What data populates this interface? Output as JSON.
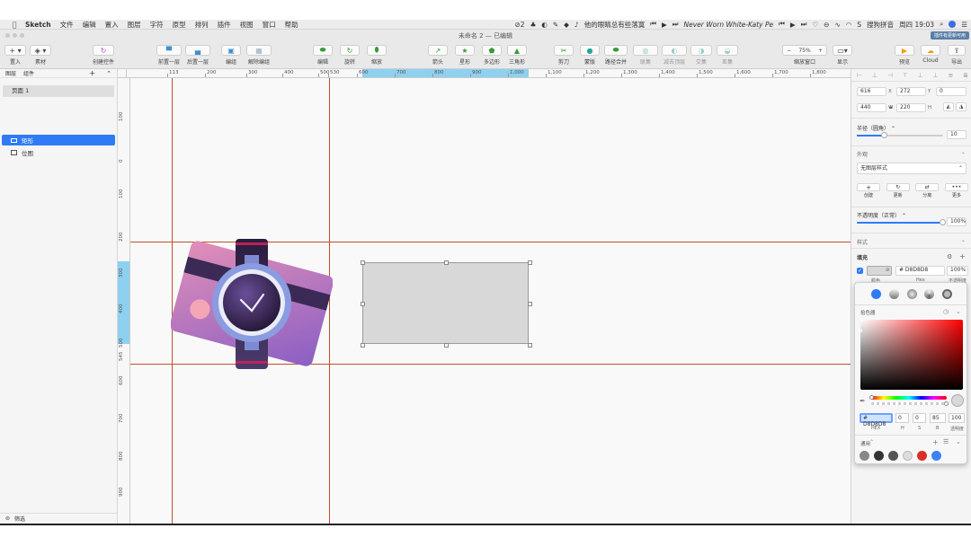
{
  "menubar": {
    "app": "Sketch",
    "items": [
      "文件",
      "编辑",
      "置入",
      "图层",
      "字符",
      "原型",
      "排列",
      "插件",
      "视图",
      "窗口",
      "帮助"
    ],
    "badge_count": "2",
    "song_title": "他的眼睛总有些落寞",
    "track_name": "Never Worn White-Katy Pe",
    "input_method": "搜狗拼音",
    "clock": "周四 19:03"
  },
  "window": {
    "title": "未命名 2 — 已编辑",
    "update_badge": "插件有更新可用"
  },
  "toolbar": {
    "insert": "置入",
    "assets": "素材",
    "create_component": "创建控件",
    "forward": "前置一层",
    "backward": "后置一层",
    "group": "编组",
    "ungroup": "解除编组",
    "edit": "编辑",
    "rotate": "旋转",
    "scale": "缩放",
    "arrow": "箭头",
    "star": "星形",
    "polygon": "多边形",
    "triangle": "三角形",
    "scissors": "剪刀",
    "mask": "蒙版",
    "path_union": "路径合并",
    "union": "联集",
    "subtract": "减去顶层",
    "intersect": "交集",
    "difference": "差集",
    "zoom_value": "75%",
    "zoom_minus": "−",
    "zoom_plus": "+",
    "zoom_label": "缩放窗口",
    "display": "显示",
    "preview": "预览",
    "cloud": "Cloud",
    "export": "导出"
  },
  "left_panel": {
    "tab_pages": "图层",
    "tab_components": "组件",
    "page_name": "页面 1",
    "layers": [
      {
        "name": "矩形",
        "selected": true
      },
      {
        "name": "位图",
        "selected": false
      }
    ],
    "filter": "筛选"
  },
  "ruler_h": {
    "labels": [
      "113",
      "200",
      "300",
      "400",
      "500",
      "530",
      "600",
      "700",
      "800",
      "900",
      "1,000",
      "1,100",
      "1,200",
      "1,300",
      "1,400",
      "1,500",
      "1,600",
      "1,700",
      "1,800"
    ]
  },
  "ruler_v": {
    "labels": [
      "100",
      "0",
      "100",
      "200",
      "300",
      "400",
      "500",
      "545",
      "600",
      "700",
      "800",
      "900"
    ]
  },
  "inspector": {
    "x": "616",
    "x_label": "X",
    "y": "272",
    "y_label": "Y",
    "rotation": "0",
    "w": "440",
    "w_label": "W",
    "h": "220",
    "h_label": "H",
    "radius_label": "半径（圆角）",
    "radius_value": "10",
    "appearance_label": "外观",
    "style_value": "无图层样式",
    "style_actions": [
      "创建",
      "更新",
      "分离",
      "更多"
    ],
    "opacity_label": "不透明度（正常）",
    "opacity_value": "100%",
    "style_section": "样式",
    "fill_label": "填充",
    "fill_hex": "# D8D8D8",
    "fill_opacity": "100%",
    "fill_sublabels": [
      "颜色",
      "Hex",
      "不透明度"
    ]
  },
  "color_picker": {
    "section": "拾色器",
    "hex_value": "# D8D8D8",
    "h": "0",
    "s": "0",
    "b": "85",
    "alpha": "100",
    "labels": [
      "HEX",
      "H",
      "S",
      "B",
      "透明度"
    ],
    "swatches_title": "通用",
    "swatches": [
      "#888888",
      "#333333",
      "#555555",
      "#dddddd",
      "#d93025",
      "#3b82f6"
    ]
  },
  "colors": {
    "accent": "#2f7bf6",
    "guide": "#c0502b",
    "rect_fill": "#d8d8d8",
    "ruler_highlight": "#8ed0ef"
  }
}
